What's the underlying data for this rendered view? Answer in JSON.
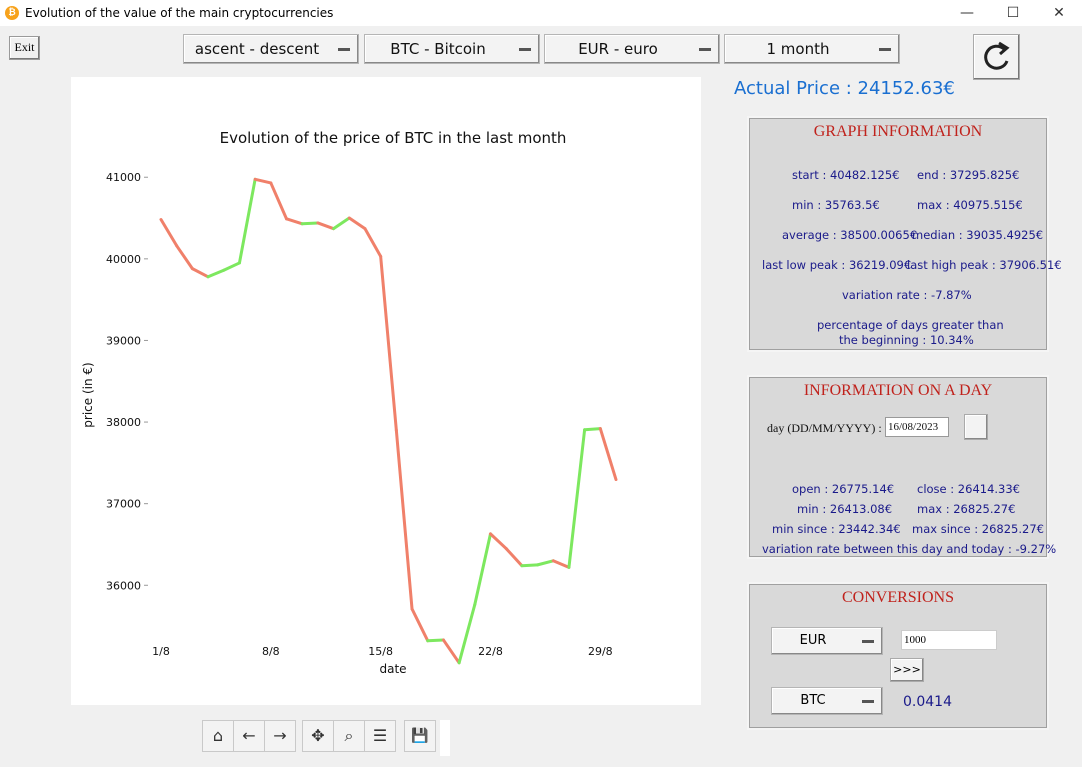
{
  "window": {
    "title": "Evolution of the value of the main cryptocurrencies",
    "minimize": "—",
    "maximize": "☐",
    "close": "✕"
  },
  "toolbar_top": {
    "exit_label": "Exit",
    "sort_combo": "ascent - descent",
    "crypto_combo": "BTC - Bitcoin",
    "currency_combo": "EUR - euro",
    "period_combo": "1 month"
  },
  "actual_price": "Actual Price : 24152.63€",
  "graph_info": {
    "title": "GRAPH INFORMATION",
    "start": "start :  40482.125€",
    "end": "end :  37295.825€",
    "min": "min :  35763.5€",
    "max": "max :  40975.515€",
    "average": "average :  38500.0065€",
    "median": "median :  39035.4925€",
    "last_low_peak": "last low peak :  36219.09€",
    "last_high_peak": "last high peak :  37906.51€",
    "variation_rate": "variation rate :  -7.87%",
    "pct_days_line1": "percentage of days greater than",
    "pct_days_line2": "the beginning :  10.34%"
  },
  "day_info": {
    "title": "INFORMATION ON A DAY",
    "day_label": "day (DD/MM/YYYY) :",
    "day_value": "16/08/2023",
    "open": "open :  26775.14€",
    "close": "close :  26414.33€",
    "min": "min :  26413.08€",
    "max": "max :  26825.27€",
    "min_since": "min since :  23442.34€",
    "max_since": "max since :  26825.27€",
    "variation_today": "variation rate between this day and today :  -9.27%"
  },
  "conversions": {
    "title": "CONVERSIONS",
    "from_currency": "EUR",
    "amount": "1000",
    "convert_button": ">>>",
    "to_currency": "BTC",
    "result": "0.0414"
  },
  "chart_data": {
    "type": "line",
    "title": "Evolution of the price of BTC in the last month",
    "xlabel": "date",
    "ylabel": "price (in €)",
    "x_ticks": [
      "1/8",
      "8/8",
      "15/8",
      "22/8",
      "29/8"
    ],
    "y_ticks": [
      "36000",
      "37000",
      "38000",
      "39000",
      "40000",
      "41000"
    ],
    "ylim": [
      35550,
      41150
    ],
    "up_color": "#7de85f",
    "down_color": "#f0806a",
    "x": [
      1,
      2,
      3,
      4,
      5,
      6,
      7,
      8,
      9,
      10,
      11,
      12,
      13,
      14,
      15,
      16,
      17,
      18,
      19,
      20,
      21,
      22,
      23,
      24,
      25,
      26,
      27,
      28,
      29,
      30,
      31
    ],
    "values": [
      40482,
      40160,
      39880,
      39780,
      39860,
      39950,
      40975,
      40930,
      40490,
      40430,
      40440,
      40370,
      40500,
      40370,
      40030,
      37900,
      35710,
      35320,
      35330,
      35050,
      35763,
      36630,
      36450,
      36240,
      36250,
      36300,
      36219,
      37906,
      37920,
      37296
    ]
  },
  "plot_tools": {
    "home": "⌂",
    "back": "←",
    "forward": "→",
    "pan": "✥",
    "zoom": "⌕",
    "configure": "☰",
    "save": "💾"
  }
}
